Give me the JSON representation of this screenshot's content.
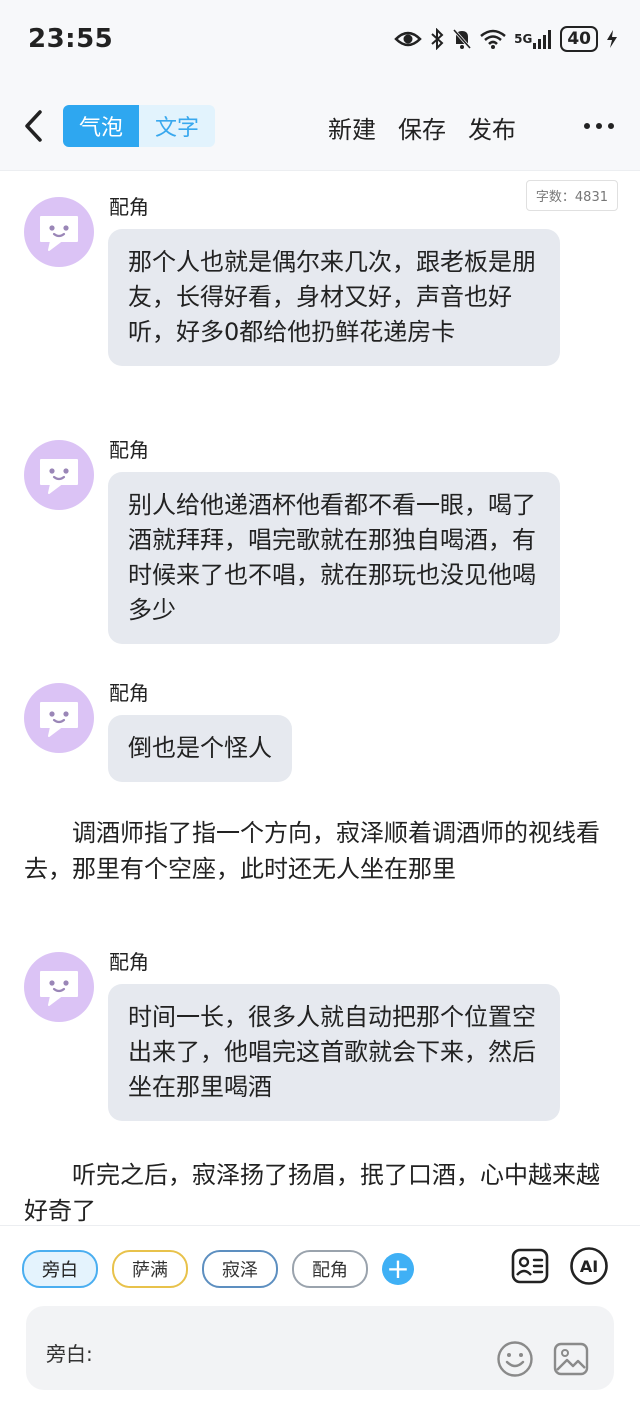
{
  "status": {
    "time": "23:55",
    "battery": "40",
    "network": "5G"
  },
  "header": {
    "tab_bubble": "气泡",
    "tab_text": "文字",
    "new_label": "新建",
    "save_label": "保存",
    "publish_label": "发布"
  },
  "word_count": "字数：4831",
  "messages": [
    {
      "name": "配角",
      "text": "那个人也就是偶尔来几次，跟老板是朋友，长得好看，身材又好，声音也好听，好多0都给他扔鲜花递房卡"
    },
    {
      "name": "配角",
      "text": "别人给他递酒杯他看都不看一眼，喝了酒就拜拜，唱完歌就在那独自喝酒，有时候来了也不唱，就在那玩也没见他喝多少"
    },
    {
      "name": "配角",
      "text": "倒也是个怪人"
    },
    {
      "name": "配角",
      "text": "时间一长，很多人就自动把那个位置空出来了，他唱完这首歌就会下来，然后坐在那里喝酒"
    }
  ],
  "narrations": [
    "调酒师指了指一个方向，寂泽顺着调酒师的视线看去，那里有个空座，此时还无人坐在那里",
    "听完之后，寂泽扬了扬眉，抿了口酒，心中越来越好奇了"
  ],
  "roles": [
    "旁白",
    "萨满",
    "寂泽",
    "配角"
  ],
  "add_role": "+",
  "ai_label": "AI",
  "input": {
    "label": "旁白:"
  },
  "icons": {
    "back": "chevron-left-icon",
    "more": "more-horizontal-icon",
    "avatar": "chat-bubble-face-icon",
    "role_list": "contact-card-icon",
    "ai": "ai-circle-icon",
    "emoji": "smiley-icon",
    "image": "image-icon"
  },
  "colors": {
    "accent": "#2ea7f0",
    "bubble": "#e6e9ef",
    "avatar": "#dbc3f5"
  }
}
